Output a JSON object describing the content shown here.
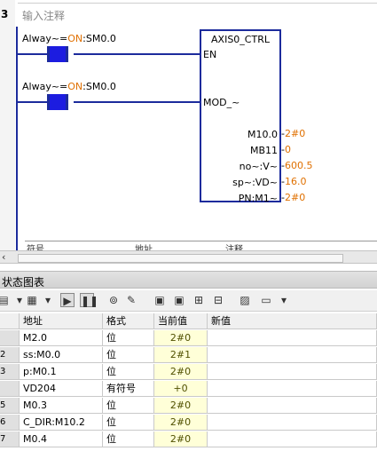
{
  "network": {
    "number": "3",
    "comment": "输入注释"
  },
  "contacts": [
    {
      "label_prefix": "Alway~=",
      "label_on": "ON",
      "label_suffix": ":SM0.0"
    },
    {
      "label_prefix": "Alway~=",
      "label_on": "ON",
      "label_suffix": ":SM0.0"
    }
  ],
  "block": {
    "title": "AXIS0_CTRL",
    "pin_en": "EN",
    "pin_mod": "MOD_~",
    "outputs": [
      {
        "name": "M10.0",
        "value": "2#0"
      },
      {
        "name": "MB11",
        "value": "0"
      },
      {
        "name": "no~:V~",
        "value": "600.5"
      },
      {
        "name": "sp~:VD~",
        "value": "16.0"
      },
      {
        "name": "PN:M1~",
        "value": "2#0"
      }
    ]
  },
  "symbol_header": [
    "符号",
    "地址",
    "注释"
  ],
  "chart": {
    "title": "状态图表",
    "columns": [
      "",
      "地址",
      "格式",
      "当前值",
      "新值"
    ],
    "rows": [
      {
        "idx": "",
        "address": "M2.0",
        "format": "位",
        "current": "2#0",
        "new": ""
      },
      {
        "idx": "2",
        "address": "ss:M0.0",
        "format": "位",
        "current": "2#1",
        "new": ""
      },
      {
        "idx": "3",
        "address": "p:M0.1",
        "format": "位",
        "current": "2#0",
        "new": ""
      },
      {
        "idx": "",
        "address": "VD204",
        "format": "有符号",
        "current": "+0",
        "new": ""
      },
      {
        "idx": "5",
        "address": "M0.3",
        "format": "位",
        "current": "2#0",
        "new": ""
      },
      {
        "idx": "6",
        "address": "C_DIR:M10.2",
        "format": "位",
        "current": "2#0",
        "new": ""
      },
      {
        "idx": "7",
        "address": "M0.4",
        "format": "位",
        "current": "2#0",
        "new": ""
      }
    ]
  },
  "colors": {
    "ladder_blue": "#1c2b9c",
    "contact_fill": "#1c1ce0",
    "on_orange": "#e07000",
    "value_cell_bg": "#ffffd8"
  }
}
